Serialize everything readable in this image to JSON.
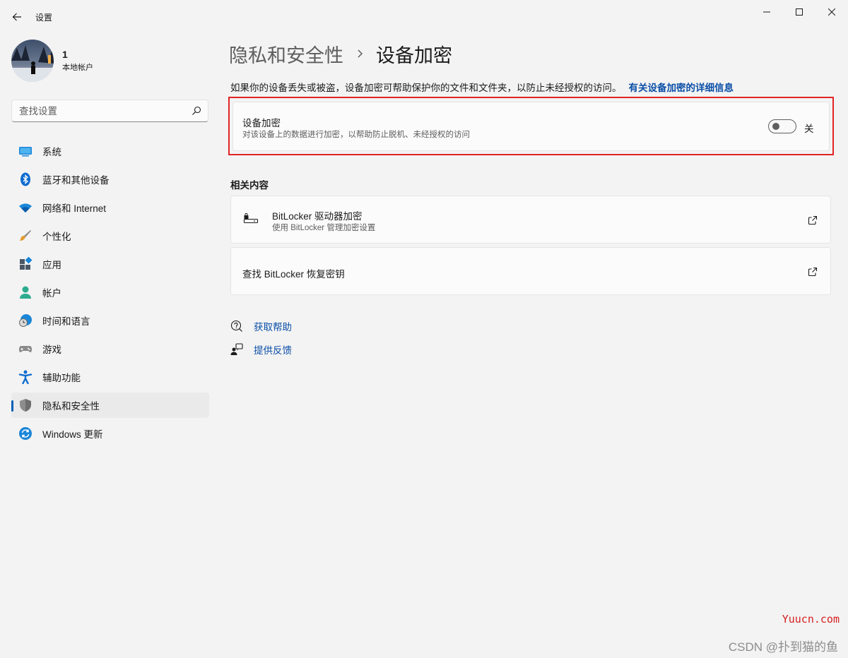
{
  "app": {
    "title": "设置"
  },
  "profile": {
    "name": "1",
    "account_type": "本地帐户"
  },
  "search": {
    "placeholder": "查找设置"
  },
  "nav": {
    "items": [
      {
        "label": "系统",
        "icon": "system-icon"
      },
      {
        "label": "蓝牙和其他设备",
        "icon": "bluetooth-icon"
      },
      {
        "label": "网络和 Internet",
        "icon": "wifi-icon"
      },
      {
        "label": "个性化",
        "icon": "paintbrush-icon"
      },
      {
        "label": "应用",
        "icon": "apps-icon"
      },
      {
        "label": "帐户",
        "icon": "account-icon"
      },
      {
        "label": "时间和语言",
        "icon": "time-language-icon"
      },
      {
        "label": "游戏",
        "icon": "gamepad-icon"
      },
      {
        "label": "辅助功能",
        "icon": "accessibility-icon"
      },
      {
        "label": "隐私和安全性",
        "icon": "shield-icon",
        "selected": true
      },
      {
        "label": "Windows 更新",
        "icon": "windows-update-icon"
      }
    ]
  },
  "breadcrumb": {
    "parent": "隐私和安全性",
    "current": "设备加密"
  },
  "description": {
    "text": "如果你的设备丢失或被盗，设备加密可帮助保护你的文件和文件夹，以防止未经授权的访问。",
    "link": "有关设备加密的详细信息"
  },
  "encryption": {
    "title": "设备加密",
    "subtitle": "对该设备上的数据进行加密，以帮助防止脱机、未经授权的访问",
    "state": "关",
    "enabled": false
  },
  "related": {
    "title": "相关内容",
    "bitlocker": {
      "title": "BitLocker 驱动器加密",
      "subtitle": "使用 BitLocker 管理加密设置"
    },
    "recovery": {
      "title": "查找 BitLocker 恢复密钥"
    }
  },
  "help": {
    "get_help": "获取帮助",
    "feedback": "提供反馈"
  },
  "watermark": {
    "site": "Yuucn.com",
    "author": "CSDN @扑到猫的鱼"
  },
  "colors": {
    "accent": "#005fb8",
    "link": "#0a4ea7",
    "highlight_border": "#e02424"
  }
}
